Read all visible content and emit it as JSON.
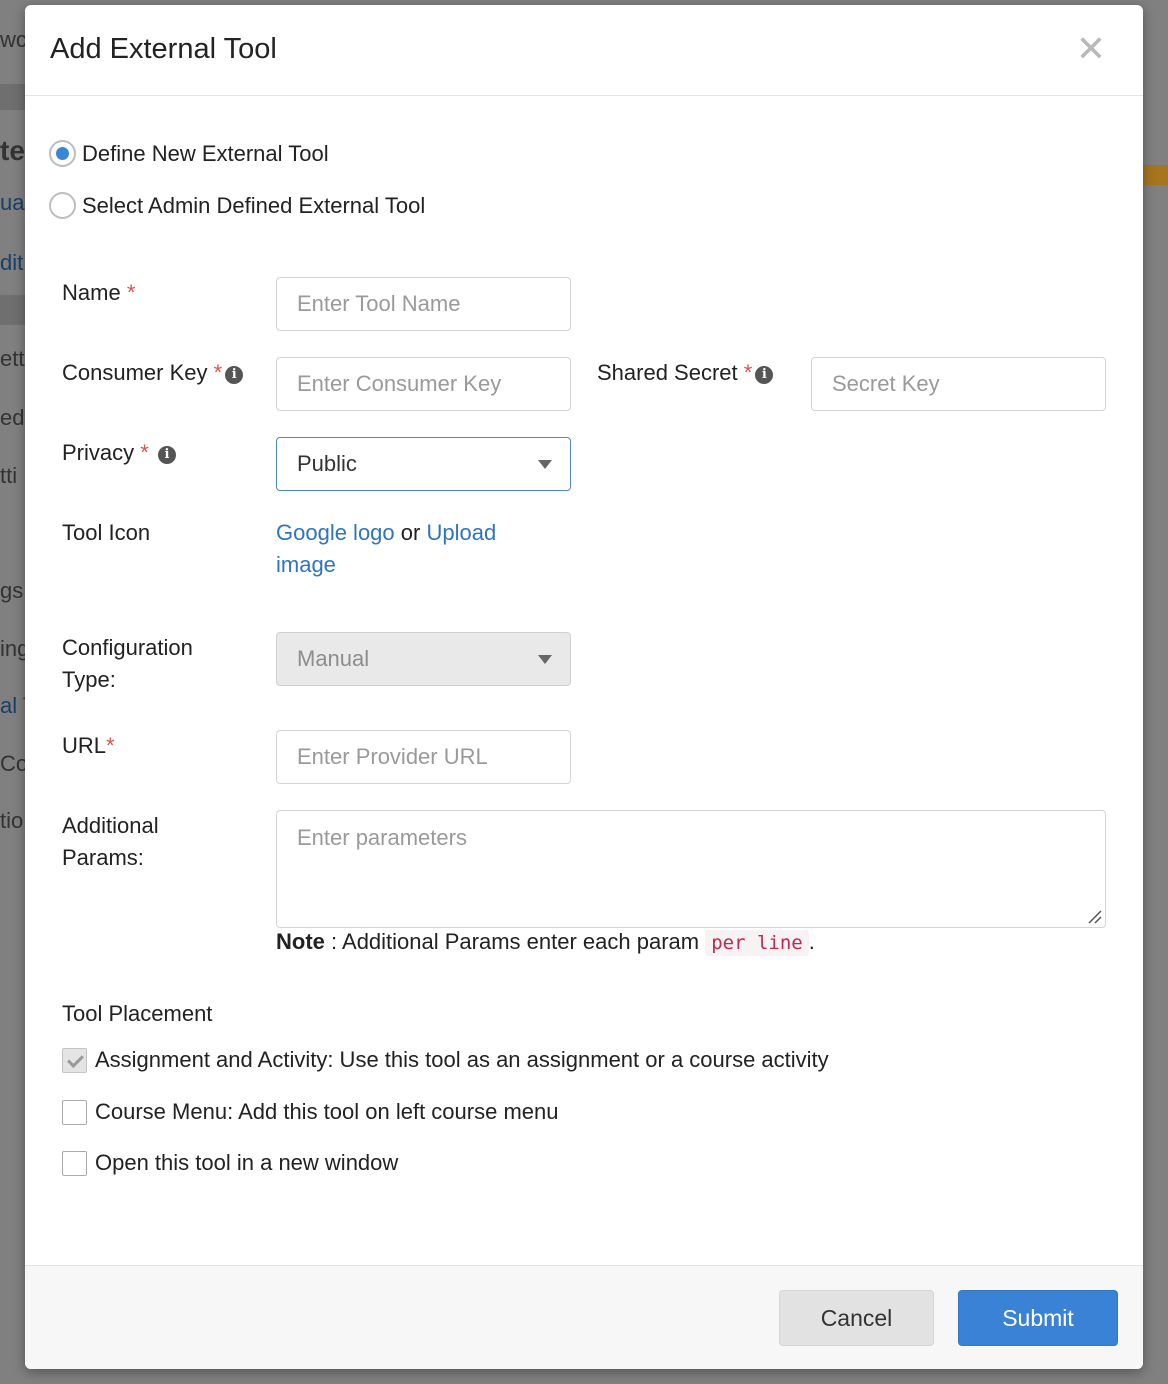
{
  "background": {
    "fragments": [
      "wc",
      "te",
      "ua",
      "dit",
      "etti",
      "ed",
      "tti",
      "gs",
      "ing",
      "al T",
      "Co",
      "tio"
    ]
  },
  "modal": {
    "title": "Add External Tool",
    "close_icon": "close-icon",
    "mode_options": [
      {
        "label": "Define New External Tool",
        "checked": true
      },
      {
        "label": "Select Admin Defined External Tool",
        "checked": false
      }
    ],
    "fields": {
      "name": {
        "label": "Name",
        "required": "*",
        "placeholder": "Enter Tool Name",
        "value": ""
      },
      "consumer_key": {
        "label": "Consumer Key",
        "required": "*",
        "placeholder": "Enter Consumer Key",
        "value": ""
      },
      "shared_secret": {
        "label": "Shared Secret",
        "required": "*",
        "placeholder": "Secret Key",
        "value": ""
      },
      "privacy": {
        "label": "Privacy",
        "required": "*",
        "value": "Public"
      },
      "tool_icon": {
        "label": "Tool Icon",
        "link1": "Google logo",
        "or": "or",
        "link2_a": "Upload",
        "link2_b": "image"
      },
      "config_type": {
        "label_a": "Configuration",
        "label_b": "Type:",
        "value": "Manual"
      },
      "url": {
        "label": "URL",
        "required": "*",
        "placeholder": "Enter Provider URL",
        "value": ""
      },
      "params": {
        "label_a": "Additional",
        "label_b": "Params:",
        "placeholder": "Enter parameters",
        "value": ""
      }
    },
    "note": {
      "bold": "Note",
      "text": " : Additional Params enter each param ",
      "code": "per line",
      "end": "."
    },
    "placement": {
      "title": "Tool Placement",
      "options": [
        {
          "label": "Assignment and Activity: Use this tool as an assignment or a course activity",
          "state": "checked-disabled"
        },
        {
          "label": "Course Menu: Add this tool on left course menu",
          "state": "unchecked"
        },
        {
          "label": "Open this tool in a new window",
          "state": "unchecked"
        }
      ]
    },
    "buttons": {
      "cancel": "Cancel",
      "submit": "Submit"
    },
    "colors": {
      "accent": "#3a82d6",
      "required": "#d9534f",
      "link": "#2f74c0"
    }
  }
}
